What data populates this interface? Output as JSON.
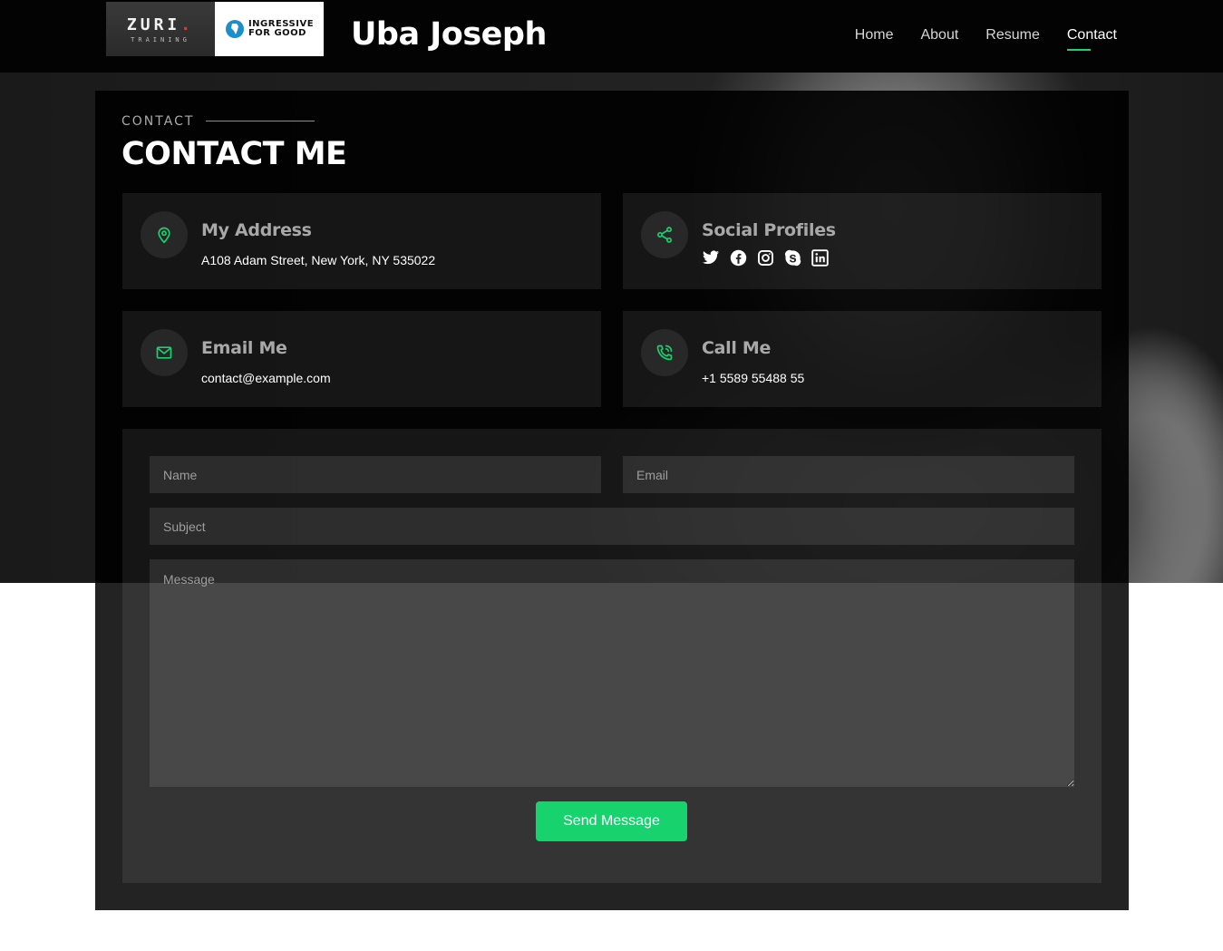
{
  "header": {
    "logo_zuri_name": "ZURI",
    "logo_zuri_dot": ".",
    "logo_zuri_sub": "TRAINING",
    "logo_i4g_line1": "INGRESSIVE",
    "logo_i4g_line2": "FOR GOOD",
    "brand_name": "Uba Joseph",
    "nav": [
      {
        "label": "Home"
      },
      {
        "label": "About"
      },
      {
        "label": "Resume"
      },
      {
        "label": "Contact"
      }
    ],
    "active_nav": "Contact"
  },
  "section": {
    "label": "CONTACT",
    "title": "CONTACT ME"
  },
  "info": {
    "address_title": "My Address",
    "address_text": "A108 Adam Street, New York, NY 535022",
    "social_title": "Social Profiles",
    "social_icons": [
      "twitter-icon",
      "facebook-icon",
      "instagram-icon",
      "skype-icon",
      "linkedin-icon"
    ],
    "email_title": "Email Me",
    "email_text": "contact@example.com",
    "call_title": "Call Me",
    "call_text": "+1 5589 55488 55"
  },
  "form": {
    "name_placeholder": "Name",
    "email_placeholder": "Email",
    "subject_placeholder": "Subject",
    "message_placeholder": "Message",
    "submit_label": "Send Message"
  },
  "colors": {
    "accent": "#18d26e",
    "navbar_bg": "#030303",
    "box_bg": "#232323"
  }
}
